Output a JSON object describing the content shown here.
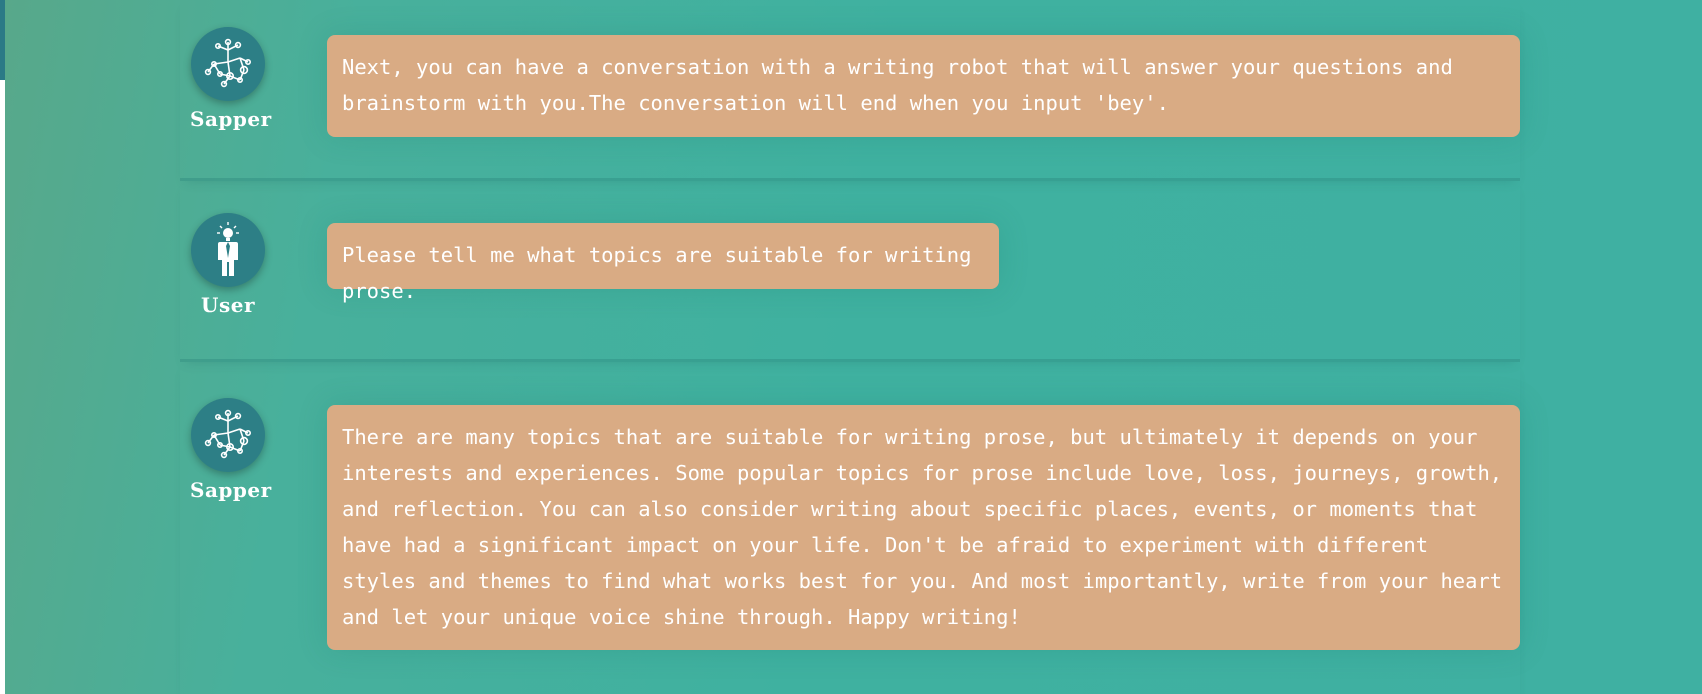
{
  "messages": [
    {
      "role": "assistant",
      "name": "Sapper",
      "avatar_icon": "network-icon",
      "text": "Next, you can have a conversation with a writing robot that will answer your questions and brainstorm with you.The conversation will end when you input 'bey'."
    },
    {
      "role": "user",
      "name": "User",
      "avatar_icon": "person-lightbulb-icon",
      "text": "Please tell me what topics are suitable for writing prose."
    },
    {
      "role": "assistant",
      "name": "Sapper",
      "avatar_icon": "network-icon",
      "text": "There are many topics that are suitable for writing prose, but ultimately it depends on your interests and experiences. Some popular topics for prose include love, loss, journeys, growth, and reflection. You can also consider writing about specific places, events, or moments that have had a significant impact on your life. Don't be afraid to experiment with different styles and themes to find what works best for you. And most importantly, write from your heart and let your unique voice shine through. Happy writing!"
    }
  ],
  "colors": {
    "bubble": "#d9ab84",
    "avatar": "#2d7f86",
    "background": "#3fb1a0"
  }
}
